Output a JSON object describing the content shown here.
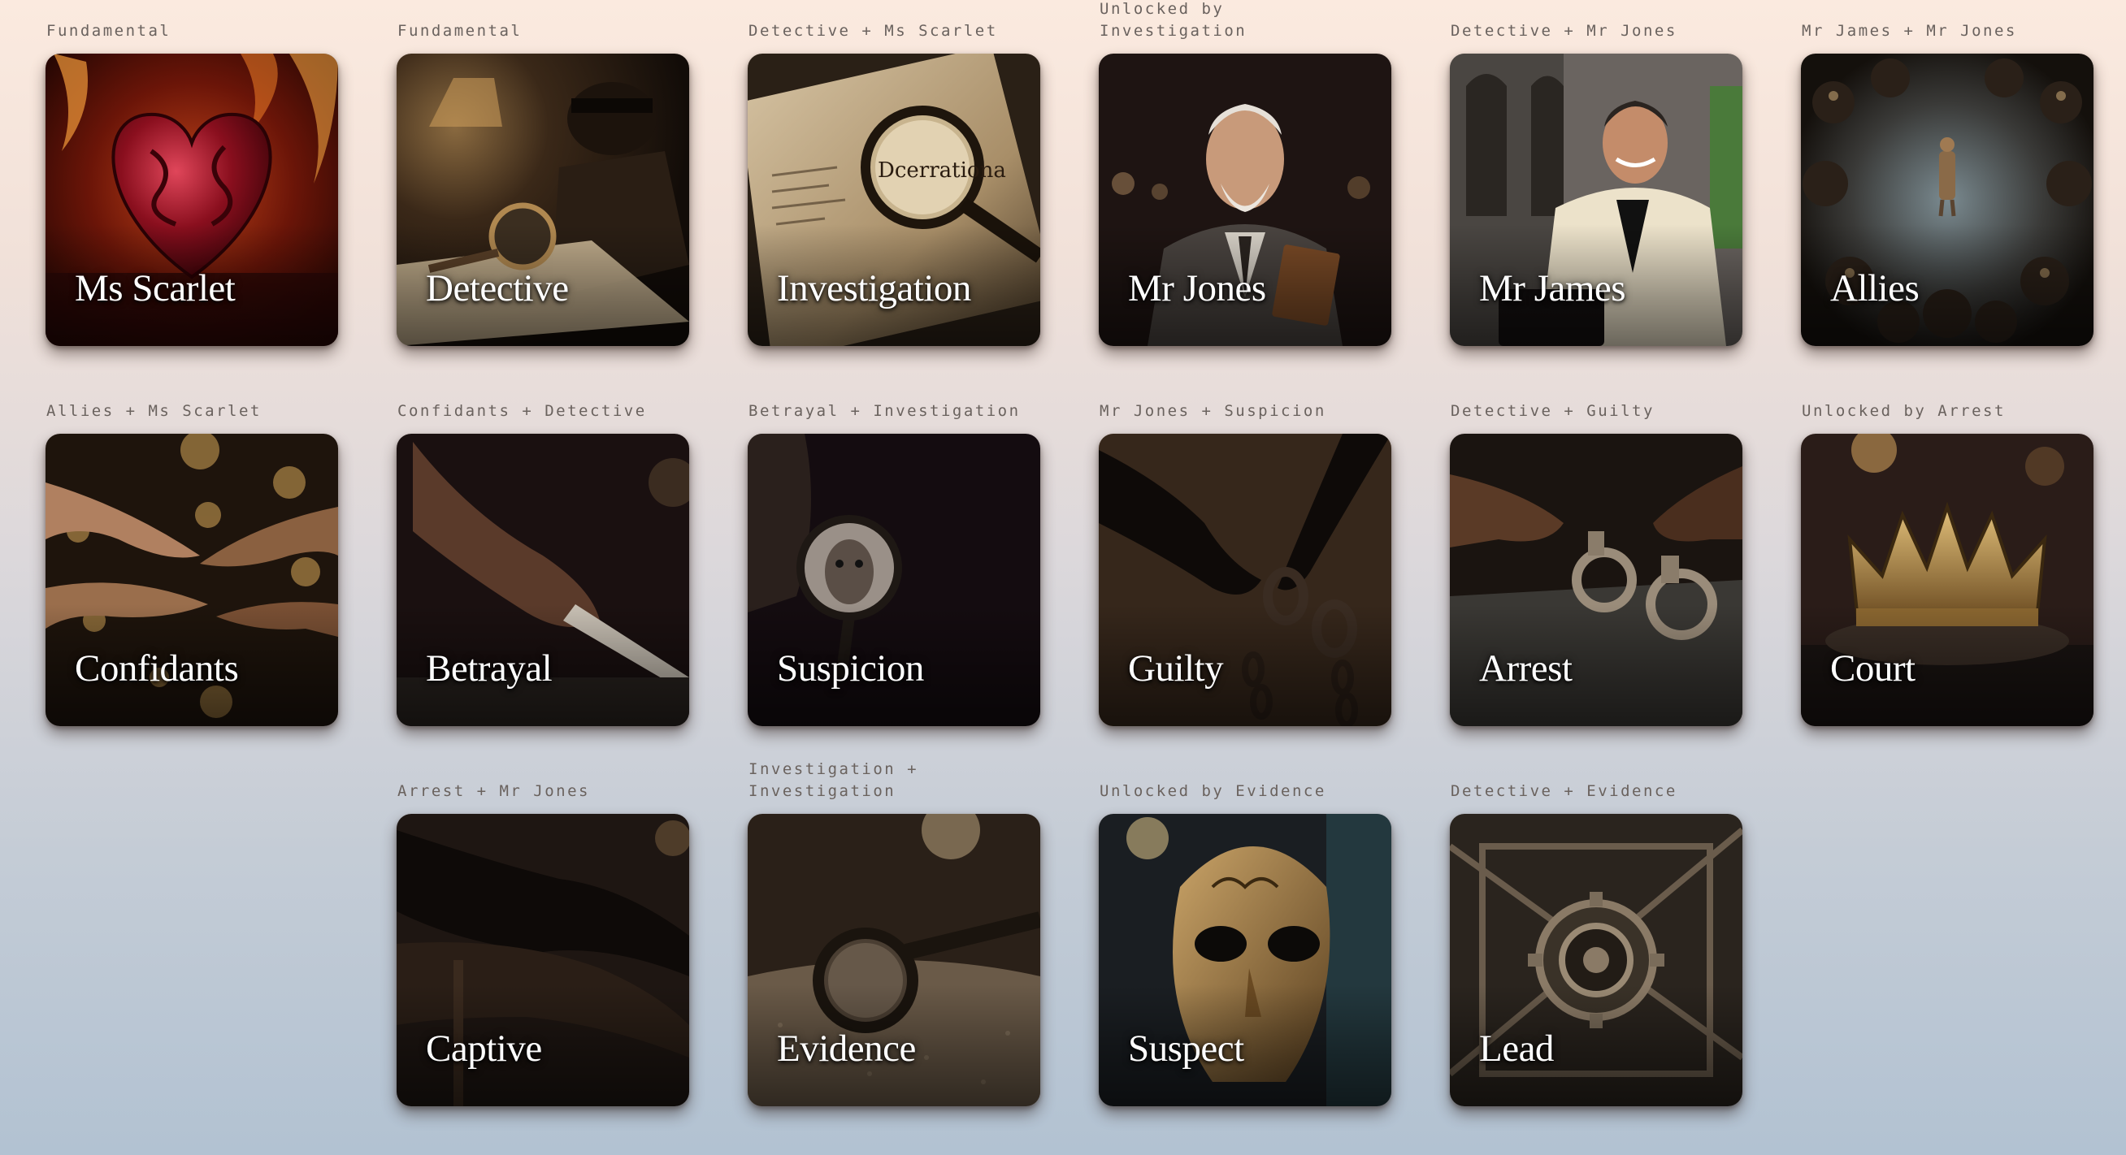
{
  "cards": [
    {
      "title": "Ms Scarlet",
      "caption": "Fundamental",
      "icon": "heart-icon"
    },
    {
      "title": "Detective",
      "caption": "Fundamental",
      "icon": "magnifier-desk-icon"
    },
    {
      "title": "Investigation",
      "caption": "Detective + Ms Scarlet",
      "icon": "document-magnifier-icon"
    },
    {
      "title": "Mr Jones",
      "caption": "Unlocked by Investigation",
      "icon": "old-man-portrait-icon"
    },
    {
      "title": "Mr James",
      "caption": "Detective + Mr Jones",
      "icon": "white-suit-man-icon"
    },
    {
      "title": "Allies",
      "caption": "Mr James + Mr Jones",
      "icon": "figures-circle-icon"
    },
    {
      "title": "Confidants",
      "caption": "Allies + Ms Scarlet",
      "icon": "touching-hands-icon"
    },
    {
      "title": "Betrayal",
      "caption": "Confidants + Detective",
      "icon": "hand-knife-icon"
    },
    {
      "title": "Suspicion",
      "caption": "Betrayal + Investigation",
      "icon": "face-magnifier-icon"
    },
    {
      "title": "Guilty",
      "caption": "Mr Jones + Suspicion",
      "icon": "chained-hands-icon"
    },
    {
      "title": "Arrest",
      "caption": "Detective + Guilty",
      "icon": "handcuffs-icon"
    },
    {
      "title": "Court",
      "caption": "Unlocked by Arrest",
      "icon": "crown-icon"
    },
    {
      "title": "Captive",
      "caption": "Arrest + Mr Jones",
      "icon": "bound-hands-icon"
    },
    {
      "title": "Evidence",
      "caption": "Investigation + Investigation",
      "icon": "magnifier-icon"
    },
    {
      "title": "Suspect",
      "caption": "Unlocked by Evidence",
      "icon": "mask-icon"
    },
    {
      "title": "Lead",
      "caption": "Detective + Evidence",
      "icon": "ornate-gear-icon"
    }
  ]
}
